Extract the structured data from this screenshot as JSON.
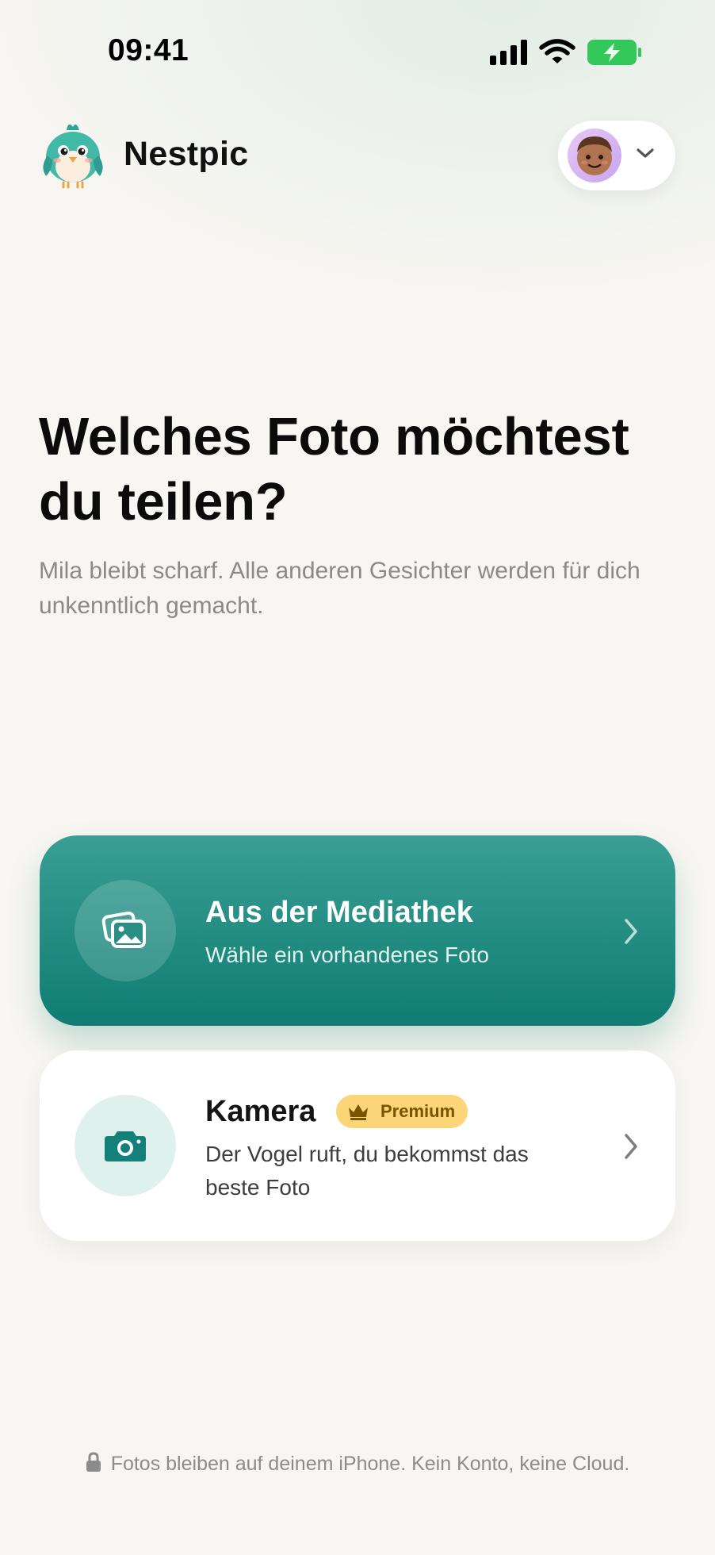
{
  "status_bar": {
    "time": "09:41",
    "icons": [
      "signal-icon",
      "wifi-icon",
      "battery-charging-icon"
    ],
    "battery_color": "#34c759"
  },
  "header": {
    "app_name": "Nestpic",
    "logo_icon": "bird-mascot-icon",
    "profile_icon": "avatar",
    "profile_menu_icon": "chevron-down-icon"
  },
  "main": {
    "headline": "Welches Foto möchtest du teilen?",
    "subtitle": "Mila bleibt scharf. Alle anderen Gesichter werden für dich unkenntlich gemacht."
  },
  "options": {
    "library": {
      "title": "Aus der Mediathek",
      "description": "Wähle ein vorhandenes Foto",
      "icon": "photo-library-icon"
    },
    "camera": {
      "title": "Kamera",
      "badge": "Premium",
      "badge_icon": "crown-icon",
      "description": "Der Vogel ruft, du bekommst das beste Foto",
      "icon": "camera-icon"
    }
  },
  "footer": {
    "note": "Fotos bleiben auf deinem iPhone. Kein Konto, keine Cloud.",
    "icon": "lock-icon"
  },
  "colors": {
    "accent": "#1b8a7e",
    "premium": "#fbd577",
    "background": "#f8f6f2"
  }
}
